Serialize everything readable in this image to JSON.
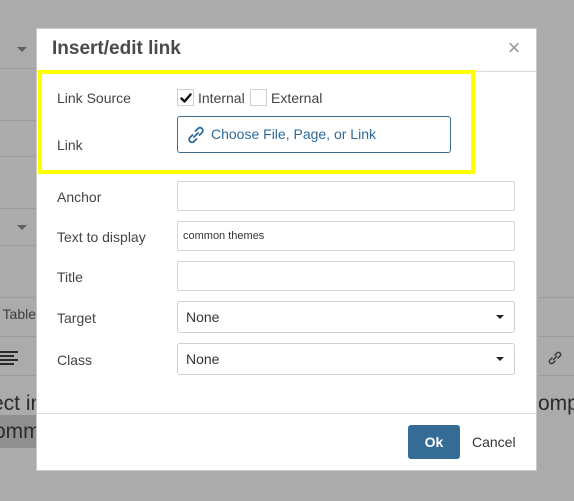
{
  "background": {
    "table_menu_label": "Table",
    "editor_line_1_left": "ect in",
    "editor_line_1_right": "omp",
    "editor_line_2_left": "omm"
  },
  "dialog": {
    "title": "Insert/edit link",
    "close_icon": "×",
    "link_source": {
      "label": "Link Source",
      "options": [
        {
          "label": "Internal",
          "checked": true
        },
        {
          "label": "External",
          "checked": false
        }
      ]
    },
    "link": {
      "label": "Link",
      "button_label": "Choose File, Page, or Link",
      "icon": "link-icon"
    },
    "anchor": {
      "label": "Anchor",
      "value": ""
    },
    "text_to_display": {
      "label": "Text to display",
      "value": "common themes"
    },
    "title_field": {
      "label": "Title",
      "value": ""
    },
    "target": {
      "label": "Target",
      "selected": "None"
    },
    "class": {
      "label": "Class",
      "selected": "None"
    },
    "footer": {
      "ok_label": "Ok",
      "cancel_label": "Cancel"
    }
  },
  "colors": {
    "highlight": "#ffff00",
    "primary": "#356c96",
    "link_text": "#2d6a9b",
    "overlay": "#ababac"
  }
}
